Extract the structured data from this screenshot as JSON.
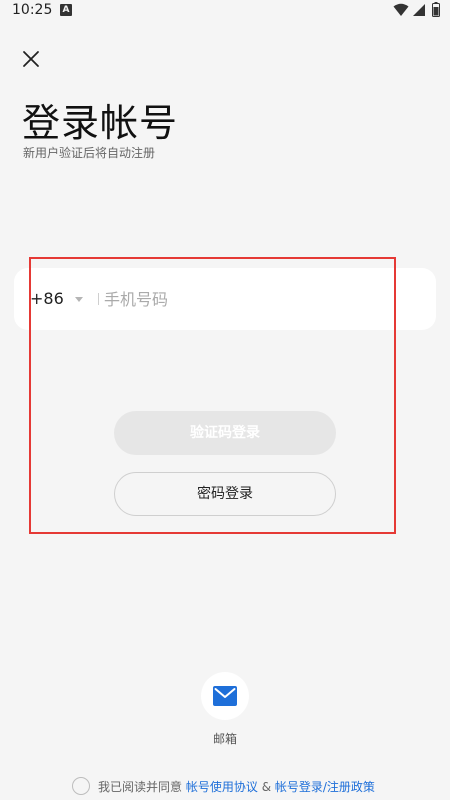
{
  "status_bar": {
    "time": "10:25",
    "notification_icon": "A"
  },
  "header": {
    "close_icon": "close-icon",
    "title": "登录帐号",
    "subtitle": "新用户验证后将自动注册"
  },
  "phone": {
    "country_code": "+86",
    "placeholder": "手机号码",
    "value": ""
  },
  "buttons": {
    "code_login": "验证码登录",
    "password_login": "密码登录"
  },
  "alt_login": {
    "email_label": "邮箱",
    "accent": "#1e6fd9"
  },
  "agreement": {
    "prefix": "我已阅读并同意",
    "link1": "帐号使用协议",
    "amp": "&",
    "link2": "帐号登录/注册政策"
  },
  "colors": {
    "background": "#f5f5f5",
    "highlight": "#e53935",
    "link": "#1e6fd9"
  }
}
